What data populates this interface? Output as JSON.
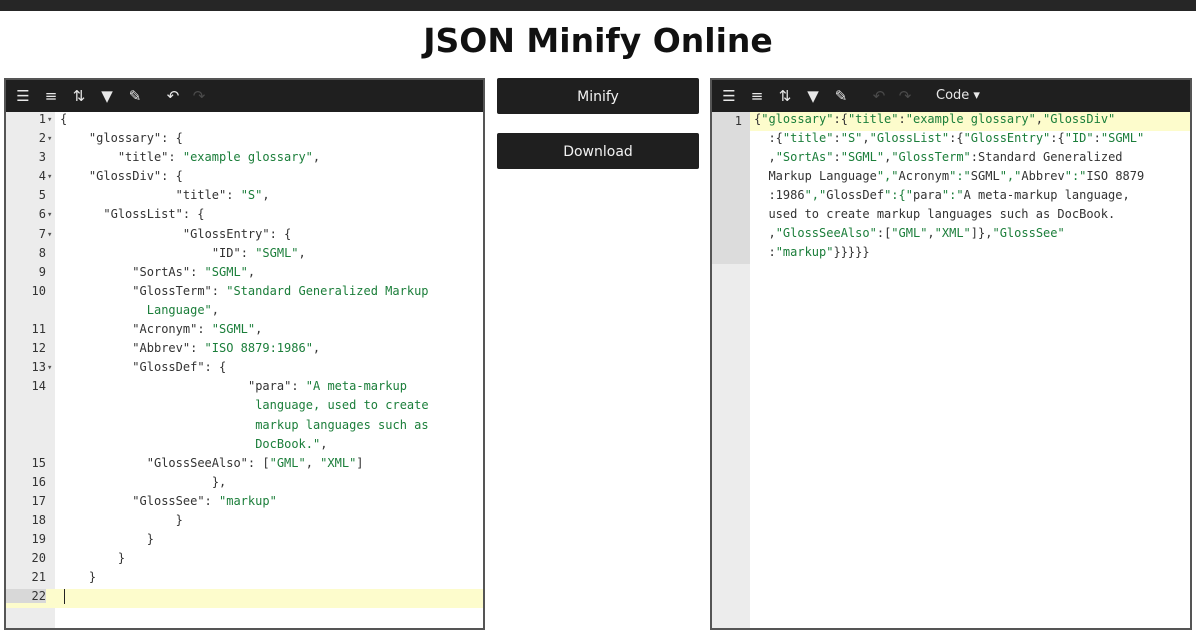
{
  "page": {
    "title": "JSON Minify Online"
  },
  "buttons": {
    "minify": "Minify",
    "download": "Download"
  },
  "right_editor": {
    "mode_label": "Code ▾",
    "line_number": "1"
  },
  "toolbar_icons": [
    "format-icon",
    "compact-icon",
    "sort-icon",
    "filter-icon",
    "repair-icon",
    "undo-icon",
    "redo-icon"
  ],
  "input_lines": [
    {
      "n": "1",
      "fold": true,
      "indent": 0,
      "parts": [
        [
          "p",
          "{"
        ]
      ]
    },
    {
      "n": "2",
      "fold": true,
      "indent": 4,
      "parts": [
        [
          "k",
          "\"glossary\""
        ],
        [
          "p",
          ": {"
        ]
      ]
    },
    {
      "n": "3",
      "fold": false,
      "indent": 8,
      "parts": [
        [
          "k",
          "\"title\""
        ],
        [
          "p",
          ": "
        ],
        [
          "s",
          "\"example glossary\""
        ],
        [
          "p",
          ","
        ]
      ]
    },
    {
      "n": "4",
      "fold": true,
      "indent": 4,
      "parts": [
        [
          "k",
          "\"GlossDiv\""
        ],
        [
          "p",
          ": {"
        ]
      ]
    },
    {
      "n": "5",
      "fold": false,
      "indent": 16,
      "parts": [
        [
          "k",
          "\"title\""
        ],
        [
          "p",
          ": "
        ],
        [
          "s",
          "\"S\""
        ],
        [
          "p",
          ","
        ]
      ]
    },
    {
      "n": "6",
      "fold": true,
      "indent": 6,
      "parts": [
        [
          "k",
          "\"GlossList\""
        ],
        [
          "p",
          ": {"
        ]
      ]
    },
    {
      "n": "7",
      "fold": true,
      "indent": 17,
      "parts": [
        [
          "k",
          "\"GlossEntry\""
        ],
        [
          "p",
          ": {"
        ]
      ]
    },
    {
      "n": "8",
      "fold": false,
      "indent": 21,
      "parts": [
        [
          "k",
          "\"ID\""
        ],
        [
          "p",
          ": "
        ],
        [
          "s",
          "\"SGML\""
        ],
        [
          "p",
          ","
        ]
      ]
    },
    {
      "n": "9",
      "fold": false,
      "indent": 10,
      "parts": [
        [
          "k",
          "\"SortAs\""
        ],
        [
          "p",
          ": "
        ],
        [
          "s",
          "\"SGML\""
        ],
        [
          "p",
          ","
        ]
      ]
    },
    {
      "n": "10",
      "fold": false,
      "indent": 10,
      "parts": [
        [
          "k",
          "\"GlossTerm\""
        ],
        [
          "p",
          ": "
        ],
        [
          "s",
          "\"Standard Generalized Markup"
        ]
      ]
    },
    {
      "n": "",
      "fold": false,
      "indent": 12,
      "parts": [
        [
          "s",
          "Language\""
        ],
        [
          "p",
          ","
        ]
      ]
    },
    {
      "n": "11",
      "fold": false,
      "indent": 10,
      "parts": [
        [
          "k",
          "\"Acronym\""
        ],
        [
          "p",
          ": "
        ],
        [
          "s",
          "\"SGML\""
        ],
        [
          "p",
          ","
        ]
      ]
    },
    {
      "n": "12",
      "fold": false,
      "indent": 10,
      "parts": [
        [
          "k",
          "\"Abbrev\""
        ],
        [
          "p",
          ": "
        ],
        [
          "s",
          "\"ISO 8879:1986\""
        ],
        [
          "p",
          ","
        ]
      ]
    },
    {
      "n": "13",
      "fold": true,
      "indent": 10,
      "parts": [
        [
          "k",
          "\"GlossDef\""
        ],
        [
          "p",
          ": {"
        ]
      ]
    },
    {
      "n": "14",
      "fold": false,
      "indent": 26,
      "parts": [
        [
          "k",
          "\"para\""
        ],
        [
          "p",
          ": "
        ],
        [
          "s",
          "\"A meta-markup"
        ]
      ]
    },
    {
      "n": "",
      "fold": false,
      "indent": 27,
      "parts": [
        [
          "s",
          "language, used to create"
        ]
      ]
    },
    {
      "n": "",
      "fold": false,
      "indent": 27,
      "parts": [
        [
          "s",
          "markup languages such as"
        ]
      ]
    },
    {
      "n": "",
      "fold": false,
      "indent": 27,
      "parts": [
        [
          "s",
          "DocBook.\""
        ],
        [
          "p",
          ","
        ]
      ]
    },
    {
      "n": "15",
      "fold": false,
      "indent": 12,
      "parts": [
        [
          "k",
          "\"GlossSeeAlso\""
        ],
        [
          "p",
          ": ["
        ],
        [
          "s",
          "\"GML\""
        ],
        [
          "p",
          ", "
        ],
        [
          "s",
          "\"XML\""
        ],
        [
          "p",
          "]"
        ]
      ]
    },
    {
      "n": "16",
      "fold": false,
      "indent": 21,
      "parts": [
        [
          "p",
          "},"
        ]
      ]
    },
    {
      "n": "17",
      "fold": false,
      "indent": 10,
      "parts": [
        [
          "k",
          "\"GlossSee\""
        ],
        [
          "p",
          ": "
        ],
        [
          "s",
          "\"markup\""
        ]
      ]
    },
    {
      "n": "18",
      "fold": false,
      "indent": 16,
      "parts": [
        [
          "p",
          "}"
        ]
      ]
    },
    {
      "n": "19",
      "fold": false,
      "indent": 12,
      "parts": [
        [
          "p",
          "}"
        ]
      ]
    },
    {
      "n": "20",
      "fold": false,
      "indent": 8,
      "parts": [
        [
          "p",
          "}"
        ]
      ]
    },
    {
      "n": "21",
      "fold": false,
      "indent": 4,
      "parts": [
        [
          "p",
          "}"
        ]
      ]
    },
    {
      "n": "22",
      "fold": false,
      "indent": 0,
      "parts": [],
      "active": true
    }
  ],
  "output_lines": [
    "{\"glossary\":{\"title\":\"example glossary\",\"GlossDiv\"",
    "  :{\"title\":\"S\",\"GlossList\":{\"GlossEntry\":{\"ID\":\"SGML\"",
    "  ,\"SortAs\":\"SGML\",\"GlossTerm\":\"Standard Generalized",
    "  Markup Language\",\"Acronym\":\"SGML\",\"Abbrev\":\"ISO 8879",
    "  :1986\",\"GlossDef\":{\"para\":\"A meta-markup language,",
    "  used to create markup languages such as DocBook.\"",
    "  ,\"GlossSeeAlso\":[\"GML\",\"XML\"]},\"GlossSee\"",
    "  :\"markup\"}}}}}"
  ],
  "colors": {
    "toolbar_bg": "#1f1f1f",
    "string_green": "#1b7e3a",
    "active_line": "#fdfccc"
  }
}
